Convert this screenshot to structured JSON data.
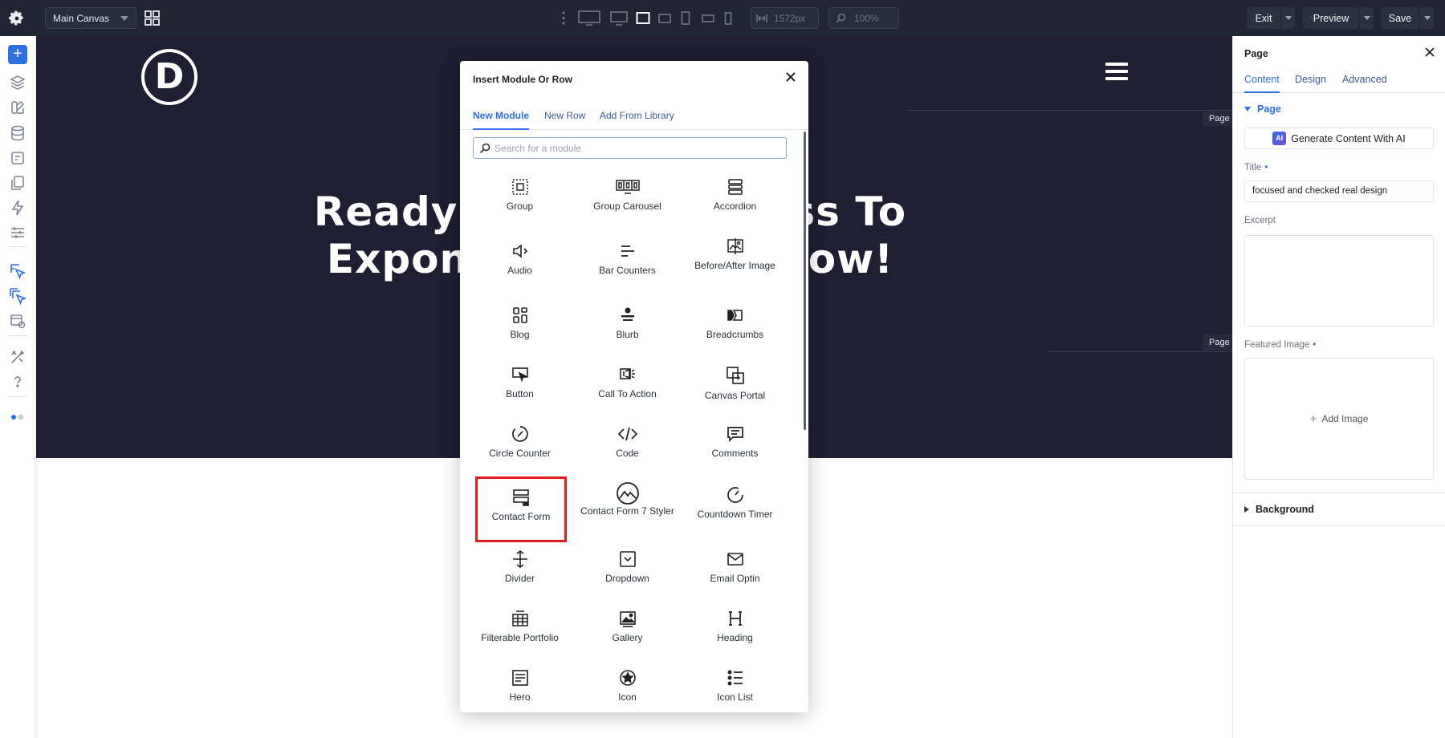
{
  "topbar": {
    "canvas_select": "Main Canvas",
    "width_value": "1572px",
    "zoom_value": "100%",
    "exit_label": "Exit",
    "preview_label": "Preview",
    "save_label": "Save"
  },
  "canvas": {
    "logo_letter": "D",
    "headline_line1": "Ready T",
    "headline_line1b": "ness To",
    "headline_line2": "Exponent",
    "headline_line2b": "Out Now!",
    "page_tag_1": "Page",
    "page_tag_2": "Page"
  },
  "modal": {
    "title": "Insert Module Or Row",
    "tabs": [
      "New Module",
      "New Row",
      "Add From Library"
    ],
    "search_placeholder": "Search for a module",
    "modules": [
      {
        "label": "Group",
        "icon": "group-icon"
      },
      {
        "label": "Group Carousel",
        "icon": "group-carousel-icon"
      },
      {
        "label": "Accordion",
        "icon": "accordion-icon"
      },
      {
        "label": "Audio",
        "icon": "audio-icon"
      },
      {
        "label": "Bar Counters",
        "icon": "bar-counters-icon"
      },
      {
        "label": "Before/After Image",
        "icon": "before-after-image-icon"
      },
      {
        "label": "Blog",
        "icon": "blog-icon"
      },
      {
        "label": "Blurb",
        "icon": "blurb-icon"
      },
      {
        "label": "Breadcrumbs",
        "icon": "breadcrumbs-icon"
      },
      {
        "label": "Button",
        "icon": "button-icon"
      },
      {
        "label": "Call To Action",
        "icon": "call-to-action-icon"
      },
      {
        "label": "Canvas Portal",
        "icon": "canvas-portal-icon"
      },
      {
        "label": "Circle Counter",
        "icon": "circle-counter-icon"
      },
      {
        "label": "Code",
        "icon": "code-icon"
      },
      {
        "label": "Comments",
        "icon": "comments-icon"
      },
      {
        "label": "Contact Form",
        "icon": "contact-form-icon"
      },
      {
        "label": "Contact Form 7 Styler",
        "icon": "contact-form-7-styler-icon"
      },
      {
        "label": "Countdown Timer",
        "icon": "countdown-timer-icon"
      },
      {
        "label": "Divider",
        "icon": "divider-icon"
      },
      {
        "label": "Dropdown",
        "icon": "dropdown-icon"
      },
      {
        "label": "Email Optin",
        "icon": "email-optin-icon"
      },
      {
        "label": "Filterable Portfolio",
        "icon": "filterable-portfolio-icon"
      },
      {
        "label": "Gallery",
        "icon": "gallery-icon"
      },
      {
        "label": "Heading",
        "icon": "heading-icon"
      },
      {
        "label": "Hero",
        "icon": "hero-icon"
      },
      {
        "label": "Icon",
        "icon": "icon-icon"
      },
      {
        "label": "Icon List",
        "icon": "icon-list-icon"
      }
    ],
    "highlight_color": "#e31b1b"
  },
  "panel": {
    "title": "Page",
    "tabs": [
      "Content",
      "Design",
      "Advanced"
    ],
    "section_page": "Page",
    "ai_badge": "AI",
    "ai_button": "Generate Content With AI",
    "title_label": "Title",
    "title_value": "focused and checked real design",
    "excerpt_label": "Excerpt",
    "featured_label": "Featured Image",
    "add_image": "Add Image",
    "section_background": "Background"
  },
  "colors": {
    "topbar_bg": "#1f2533",
    "accent": "#2f6fe4",
    "hero_bg": "#1f1e32"
  }
}
